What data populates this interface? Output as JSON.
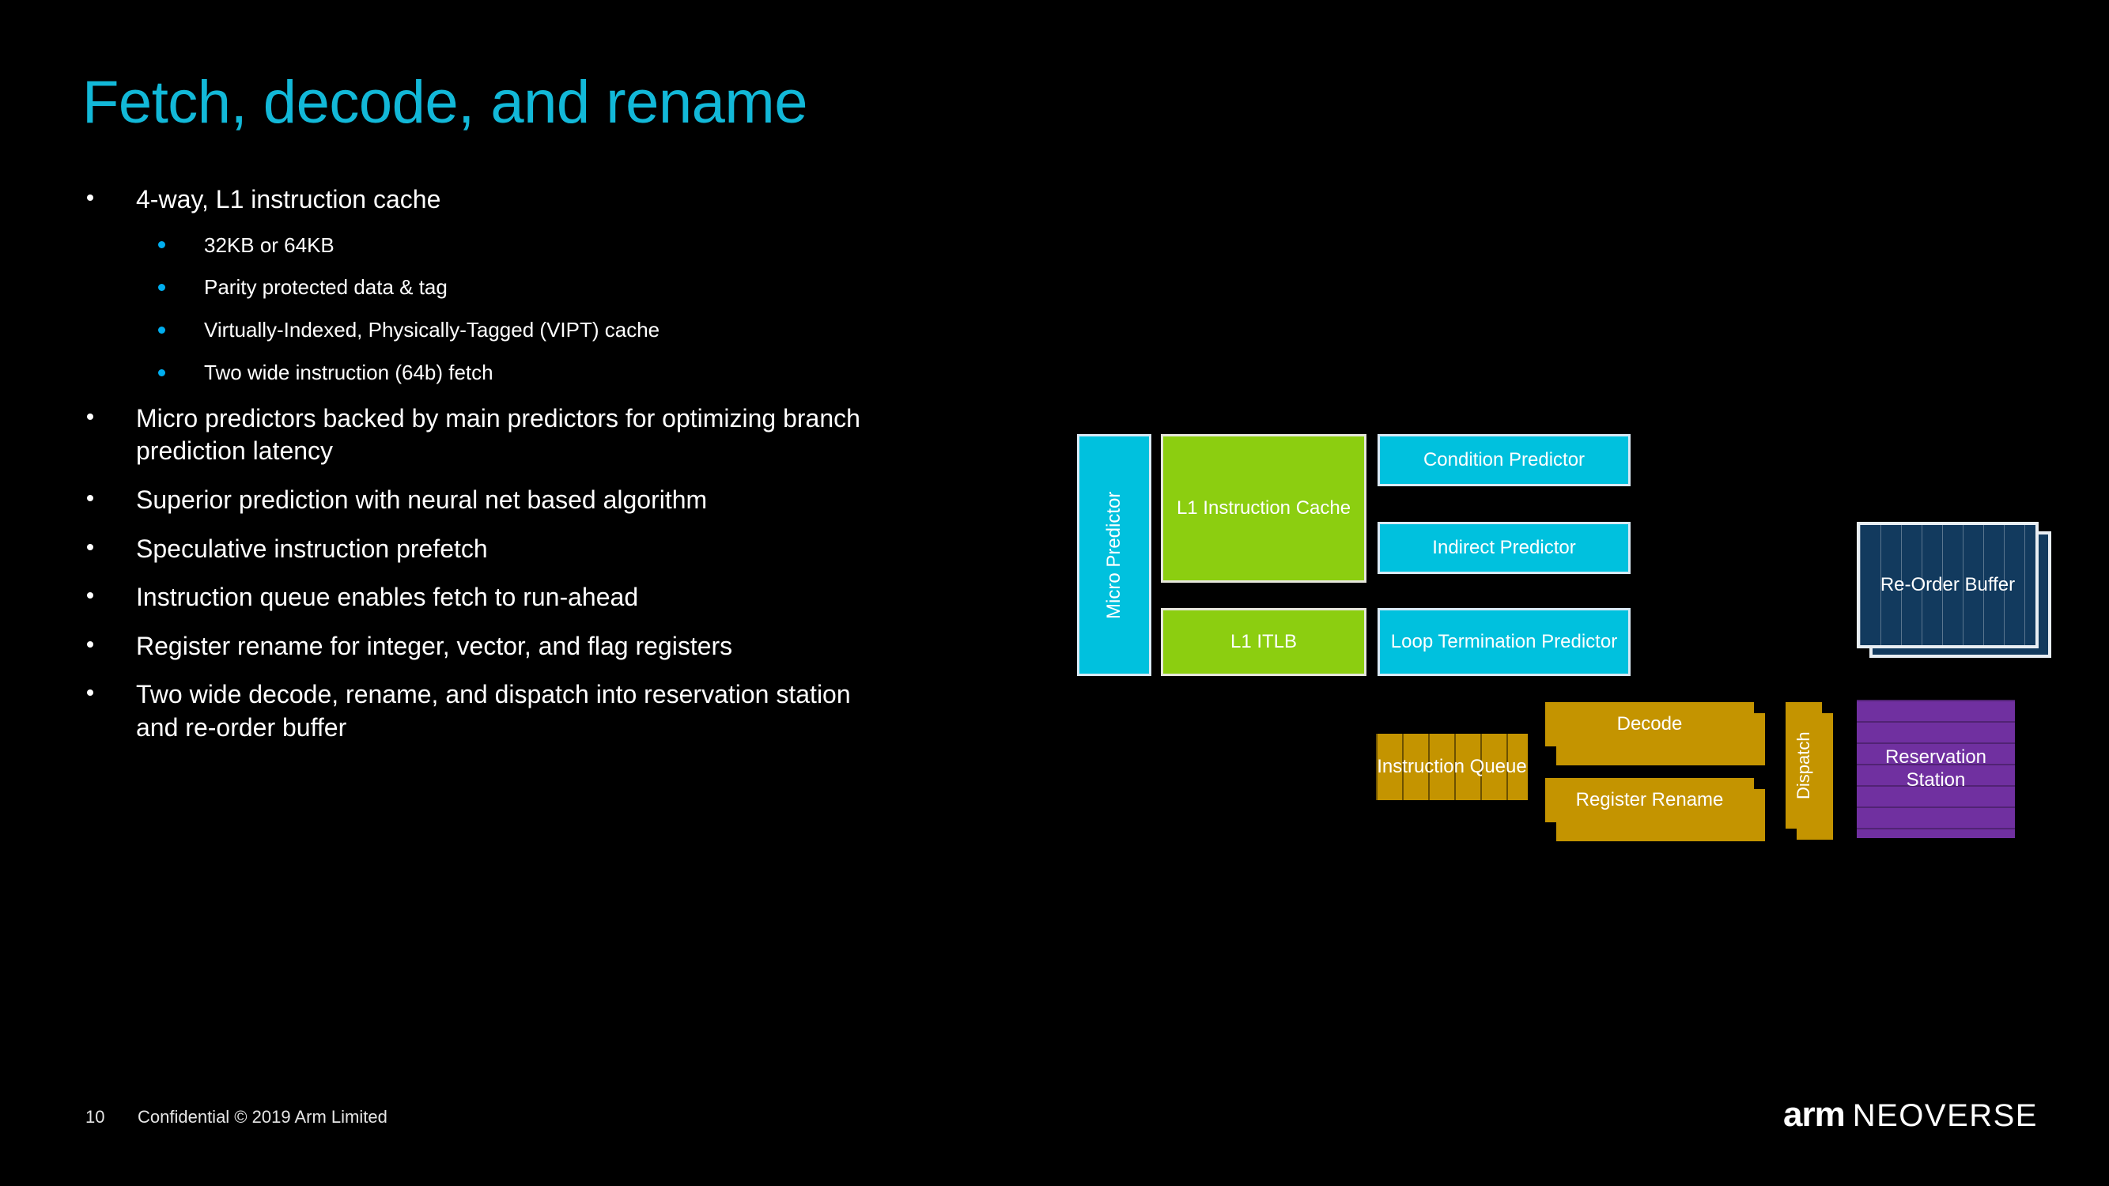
{
  "slide": {
    "title": "Fetch, decode, and rename",
    "accent_color": "#12B8D8",
    "background_color": "#000000"
  },
  "bullets": [
    {
      "level": 1,
      "text": "4-way, L1 instruction cache"
    },
    {
      "level": 2,
      "text": "32KB or 64KB"
    },
    {
      "level": 2,
      "text": "Parity protected data & tag"
    },
    {
      "level": 2,
      "text": "Virtually-Indexed, Physically-Tagged (VIPT) cache"
    },
    {
      "level": 2,
      "text": "Two wide instruction (64b) fetch"
    },
    {
      "level": 1,
      "text": "Micro predictors backed by main predictors for optimizing branch prediction latency"
    },
    {
      "level": 1,
      "text": "Superior prediction with neural net based algorithm"
    },
    {
      "level": 1,
      "text": "Speculative instruction prefetch"
    },
    {
      "level": 1,
      "text": "Instruction queue enables fetch to run-ahead"
    },
    {
      "level": 1,
      "text": "Register rename for integer, vector, and flag registers"
    },
    {
      "level": 1,
      "text": "Two wide decode, rename, and dispatch into reservation station and re-order buffer"
    }
  ],
  "diagram": {
    "blocks": {
      "micro_predictor": "Micro Predictor",
      "l1_instruction_cache": "L1 Instruction Cache",
      "l1_itlb": "L1 ITLB",
      "condition_predictor": "Condition Predictor",
      "indirect_predictor": "Indirect Predictor",
      "loop_termination_predictor": "Loop Termination Predictor",
      "instruction_queue": "Instruction Queue",
      "decode": "Decode",
      "register_rename": "Register Rename",
      "dispatch": "Dispatch",
      "reorder_buffer": "Re-Order Buffer",
      "reservation_station": "Reservation Station"
    },
    "colors": {
      "cyan": "#00C1DE",
      "green": "#8CCE10",
      "gold": "#C49400",
      "navy": "#123A5E",
      "purple": "#7030A0"
    }
  },
  "footer": {
    "page_number": "10",
    "confidential": "Confidential © 2019 Arm Limited",
    "logo_arm": "arm",
    "logo_product": "NEOVERSE"
  }
}
